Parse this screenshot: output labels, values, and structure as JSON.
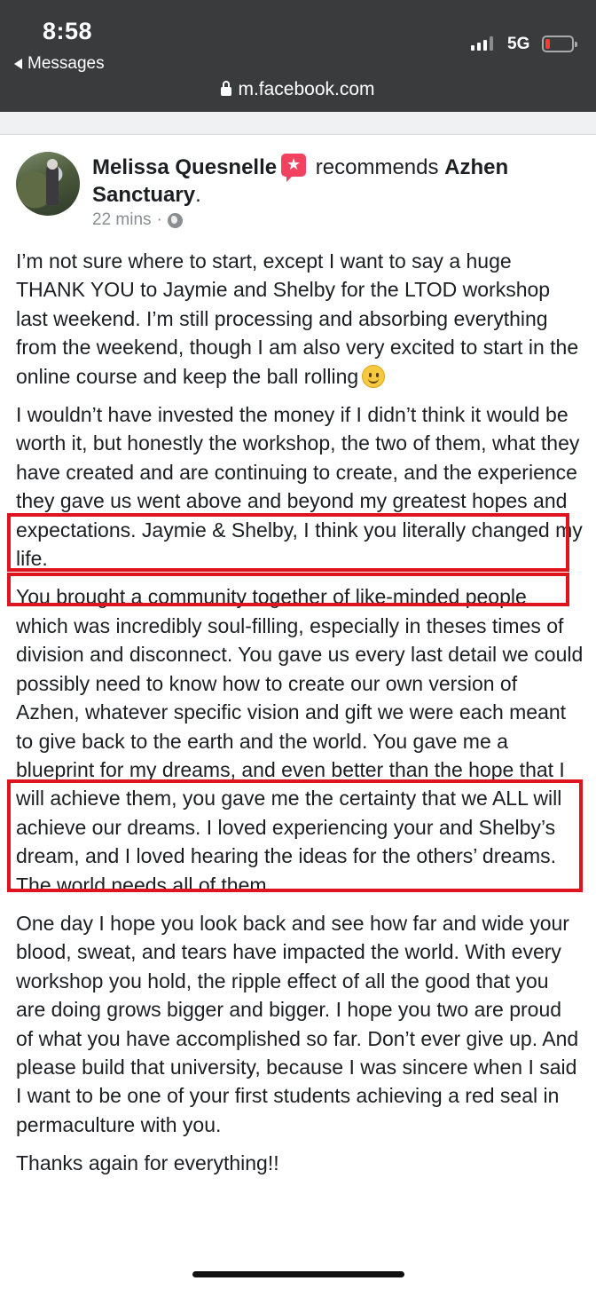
{
  "status_bar": {
    "time": "8:58",
    "back_label": "Messages",
    "network": "5G",
    "url": "m.facebook.com",
    "icons": [
      "back-arrow-icon",
      "signal-icon",
      "battery-icon",
      "lock-icon"
    ],
    "battery_color": "#ff3b30"
  },
  "post": {
    "author": "Melissa Quesnelle",
    "action": "recommends",
    "page_name": "Azhen Sanctuary",
    "period": ".",
    "timestamp": "22 mins",
    "separator": "·",
    "paragraphs": [
      "I’m not sure where to start, except I want to say a huge THANK YOU to Jaymie and Shelby for the LTOD workshop last weekend. I’m still processing and absorbing everything from the weekend, though I am also very excited to start in the online course and keep the ball rolling",
      "I wouldn’t have invested the money if I didn’t think it would be worth it, but honestly the workshop, the two of them, what they have created and are continuing to create, and the experience they gave us went above and beyond my greatest hopes and expectations. Jaymie & Shelby, I think you literally changed my life.",
      "You brought a community together of like-minded people which was incredibly soul-filling, especially in theses times of division and disconnect. You gave us every last detail we could possibly need to know how to create our own version of Azhen, whatever specific vision and gift we were each meant to give back to the earth and the world. You gave me a blueprint for my dreams, and even better than the hope that I will achieve them, you gave me the certainty that we ALL will achieve our dreams. I loved experiencing your and Shelby’s dream, and I loved hearing the ideas for the others’ dreams. The world needs all of them.",
      "One day I hope you look back and see how far and wide your blood, sweat, and tears have impacted the world. With every workshop you hold, the ripple effect of all the good that you are doing grows bigger and bigger. I hope you two are proud of what you have accomplished so far. Don’t ever give up. And please build that university, because I was sincere when I said I want to be one of your first students achieving a red seal in permaculture with you.",
      "Thanks again for everything!!"
    ],
    "icons": [
      "recommendation-icon",
      "globe-icon",
      "smile-emoji-icon"
    ],
    "highlight_color": "#e0141e"
  }
}
